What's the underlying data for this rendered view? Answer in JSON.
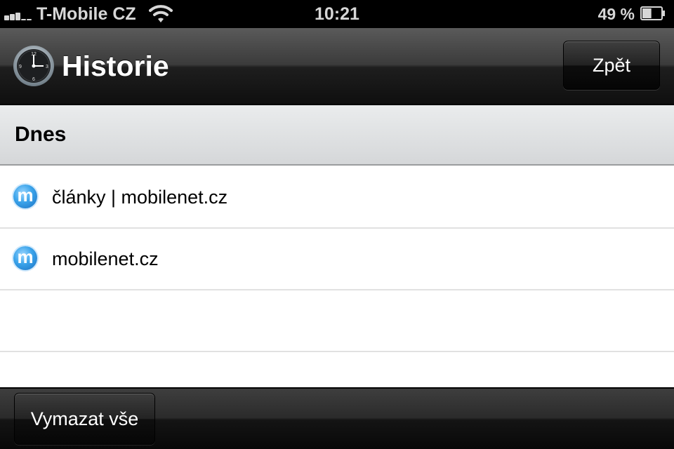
{
  "status_bar": {
    "carrier": "T-Mobile CZ",
    "time": "10:21",
    "battery_percent": "49 %",
    "battery_level": 0.49,
    "signal_bars": 3
  },
  "nav_bar": {
    "title": "Historie",
    "back_label": "Zpět",
    "icon": "clock-icon"
  },
  "section": {
    "title": "Dnes"
  },
  "history": {
    "items": [
      {
        "label": "články | mobilenet.cz",
        "icon": "mobilenet-favicon",
        "favicon_letter": "m"
      },
      {
        "label": "mobilenet.cz",
        "icon": "mobilenet-favicon",
        "favicon_letter": "m"
      }
    ]
  },
  "toolbar": {
    "clear_label": "Vymazat vše"
  },
  "colors": {
    "favicon": "#3aa3ea",
    "navbar": "#3b3b3b",
    "section_header": "#dfe1e3"
  }
}
